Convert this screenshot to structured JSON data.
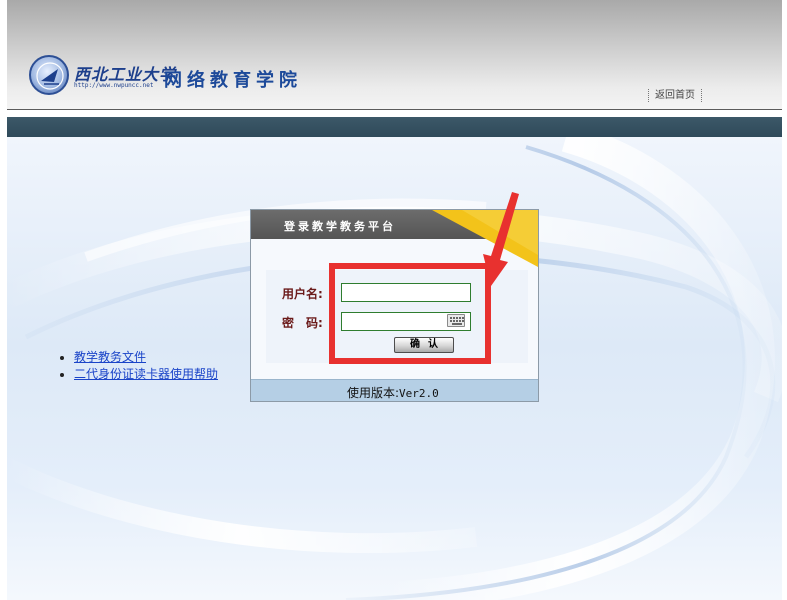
{
  "header": {
    "university_name": "西北工业大学",
    "university_url": "http://www.nwpuncc.net",
    "school_name": "网络教育学院",
    "home_link": "返回首页"
  },
  "links": [
    {
      "label": "教学教务文件"
    },
    {
      "label": "二代身份证读卡器使用帮助"
    }
  ],
  "login": {
    "title": "登录教学教务平台",
    "username_label": "用户名:",
    "username_value": "",
    "password_label": "密　码:",
    "password_value": "",
    "submit_label": "确认",
    "version_label": "使用版本:",
    "version_value": "Ver2.0"
  },
  "colors": {
    "nav_bar": "#2f4a5a",
    "field_border": "#2f7d2f",
    "annotation": "#e8312f",
    "corner_accent": "#f3c31a"
  },
  "icons": [
    "university-emblem-icon",
    "keyboard-icon",
    "arrow-annotation"
  ]
}
